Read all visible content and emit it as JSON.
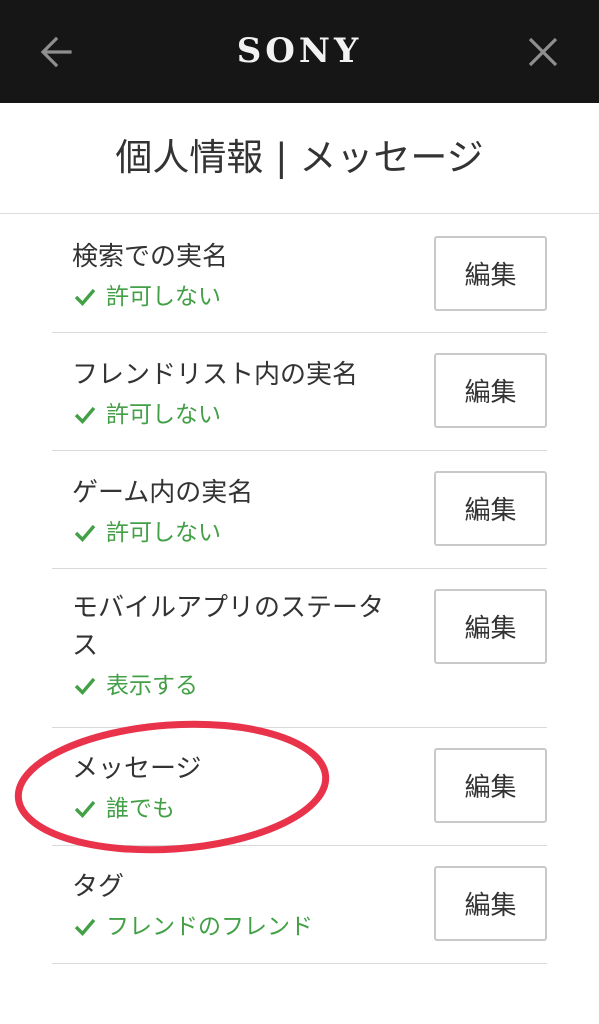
{
  "header": {
    "logo": "SONY",
    "back_icon": "arrow-left-icon",
    "close_icon": "close-icon"
  },
  "page": {
    "title": "個人情報 | メッセージ"
  },
  "settings": [
    {
      "label": "検索での実名",
      "status": "許可しない",
      "button": "編集"
    },
    {
      "label": "フレンドリスト内の実名",
      "status": "許可しない",
      "button": "編集"
    },
    {
      "label": "ゲーム内の実名",
      "status": "許可しない",
      "button": "編集"
    },
    {
      "label": "モバイルアプリのステータス",
      "status": "表示する",
      "button": "編集"
    },
    {
      "label": "メッセージ",
      "status": "誰でも",
      "button": "編集"
    },
    {
      "label": "タグ",
      "status": "フレンドのフレンド",
      "button": "編集"
    }
  ],
  "colors": {
    "header_bg": "#161616",
    "status_green": "#43a047",
    "highlight_red": "#e8334a"
  }
}
